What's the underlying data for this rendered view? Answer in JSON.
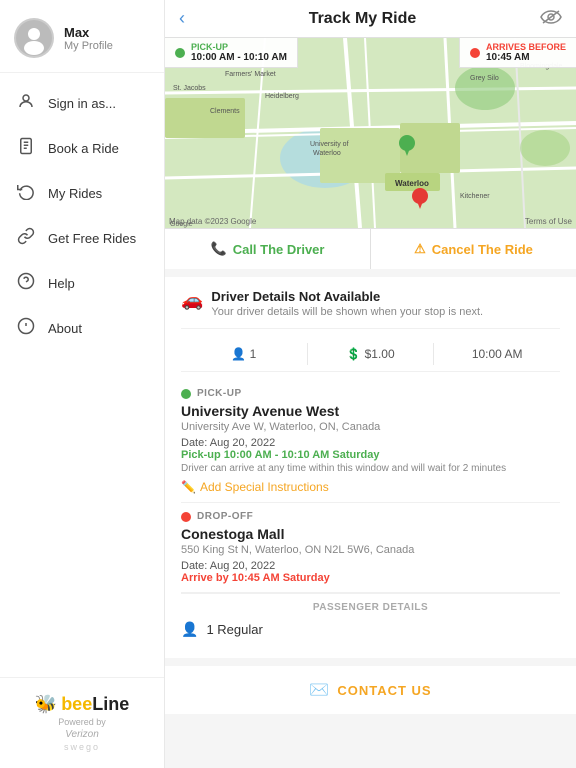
{
  "app": {
    "title": "Track My Ride"
  },
  "sidebar": {
    "profile": {
      "name": "Max",
      "sub": "My Profile"
    },
    "nav": [
      {
        "id": "sign-in",
        "icon": "👤",
        "label": "Sign in as..."
      },
      {
        "id": "book-ride",
        "icon": "📱",
        "label": "Book a Ride"
      },
      {
        "id": "my-rides",
        "icon": "🔄",
        "label": "My Rides"
      },
      {
        "id": "free-rides",
        "icon": "🔗",
        "label": "Get Free Rides"
      },
      {
        "id": "help",
        "icon": "?",
        "label": "Help"
      },
      {
        "id": "about",
        "icon": "ℹ",
        "label": "About"
      }
    ],
    "footer": {
      "logo_bee": "bee",
      "logo_line": "Line",
      "powered_by": "Powered by",
      "brand": "Verizon",
      "sub": "swego"
    }
  },
  "map": {
    "pickup_label": "PICK-UP",
    "pickup_time": "10:00 AM - 10:10 AM",
    "arrives_label": "ARRIVES BEFORE",
    "arrives_time": "10:45 AM",
    "attribution": "Map data ©2023 Google",
    "terms": "Terms of Use"
  },
  "actions": {
    "call_label": "Call The Driver",
    "cancel_label": "Cancel The Ride"
  },
  "driver": {
    "unavail_title": "Driver Details Not Available",
    "unavail_sub": "Your driver details will be shown when your stop is next.",
    "stat_passengers": "1",
    "stat_cost": "$1.00",
    "stat_time": "10:00 AM"
  },
  "pickup": {
    "type": "PICK-UP",
    "name": "University Avenue West",
    "address": "University Ave W, Waterloo, ON, Canada",
    "date": "Date: Aug 20, 2022",
    "time_range": "Pick-up 10:00 AM - 10:10 AM Saturday",
    "note": "Driver can arrive at any time within this window and will wait for 2 minutes",
    "add_instructions": "Add Special Instructions"
  },
  "dropoff": {
    "type": "DROP-OFF",
    "name": "Conestoga Mall",
    "address": "550 King St N, Waterloo, ON N2L 5W6, Canada",
    "date": "Date: Aug 20, 2022",
    "time": "Arrive by 10:45 AM Saturday"
  },
  "passenger": {
    "header": "PASSENGER DETAILS",
    "count": "1 Regular"
  },
  "contact": {
    "label": "CONTACT US"
  }
}
